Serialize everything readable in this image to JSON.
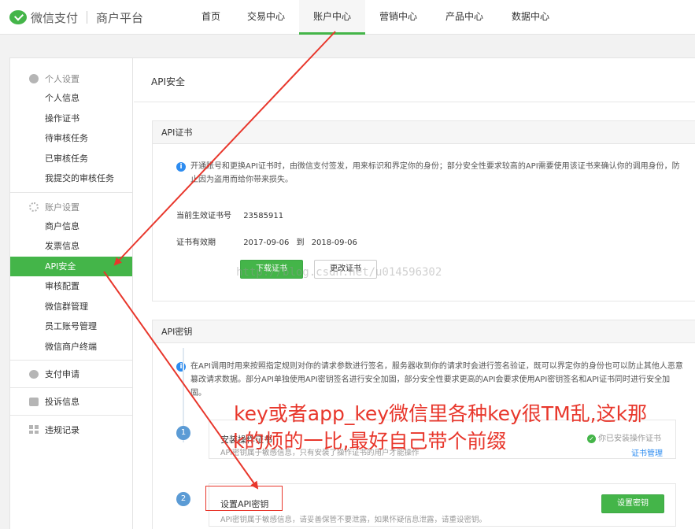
{
  "header": {
    "brand": "微信支付",
    "platform": "商户平台",
    "nav": [
      {
        "label": "首页"
      },
      {
        "label": "交易中心"
      },
      {
        "label": "账户中心"
      },
      {
        "label": "营销中心"
      },
      {
        "label": "产品中心"
      },
      {
        "label": "数据中心"
      }
    ],
    "active_nav": "账户中心",
    "accent_color": "#44b549"
  },
  "sidebar": {
    "personal_group": "个人设置",
    "personal_items": [
      "个人信息",
      "操作证书",
      "待审核任务",
      "已审核任务",
      "我提交的审核任务"
    ],
    "account_group": "账户设置",
    "account_items": [
      "商户信息",
      "发票信息",
      "API安全",
      "审核配置",
      "微信群管理",
      "员工账号管理",
      "微信商户终端"
    ],
    "active_item": "API安全",
    "singles": [
      {
        "label": "支付申请",
        "icon": "chat-icon"
      },
      {
        "label": "投诉信息",
        "icon": "message-icon"
      },
      {
        "label": "违规记录",
        "icon": "grid-icon"
      }
    ]
  },
  "main": {
    "page_title": "API安全",
    "cert": {
      "title": "API证书",
      "info": "开通账号和更换API证书时，由微信支付签发，用来标识和界定你的身份；部分安全性要求较高的API需要使用该证书来确认你的调用身份，防止因为盗用而给你带来损失。",
      "serial_label": "当前生效证书号",
      "serial_value": "23585911",
      "validity_label": "证书有效期",
      "valid_from": "2017-09-06",
      "valid_to_sep": "到",
      "valid_to": "2018-09-06",
      "download_label": "下载证书",
      "change_label": "更改证书"
    },
    "key": {
      "title": "API密钥",
      "info": "在API调用时用来按照指定规则对你的请求参数进行签名，服务器收到你的请求时会进行签名验证，既可以界定你的身份也可以防止其他人恶意篡改请求数据。部分API单独使用API密钥签名进行安全加固，部分安全性要求更高的API会要求使用API密钥签名和API证书同时进行安全加固。",
      "step1": {
        "number": "1",
        "title": "安装操作证书",
        "desc": "API密钥属于敏感信息，只有安装了操作证书的用户才能操作",
        "status": "你已安装操作证书",
        "link": "证书管理"
      },
      "step2": {
        "number": "2",
        "title": "设置API密钥",
        "desc": "API密钥属于敏感信息，请妥善保管不要泄露，如果怀疑信息泄露，请重设密钥。",
        "button": "设置密钥"
      }
    }
  },
  "annotation": {
    "line1": "key或者app_key微信里各种key很TM乱,这k那",
    "line2": "k的烦的一比,最好自己带个前缀",
    "color": "#e8372c"
  },
  "watermark": "http://blog.csdn.net/u014596302"
}
